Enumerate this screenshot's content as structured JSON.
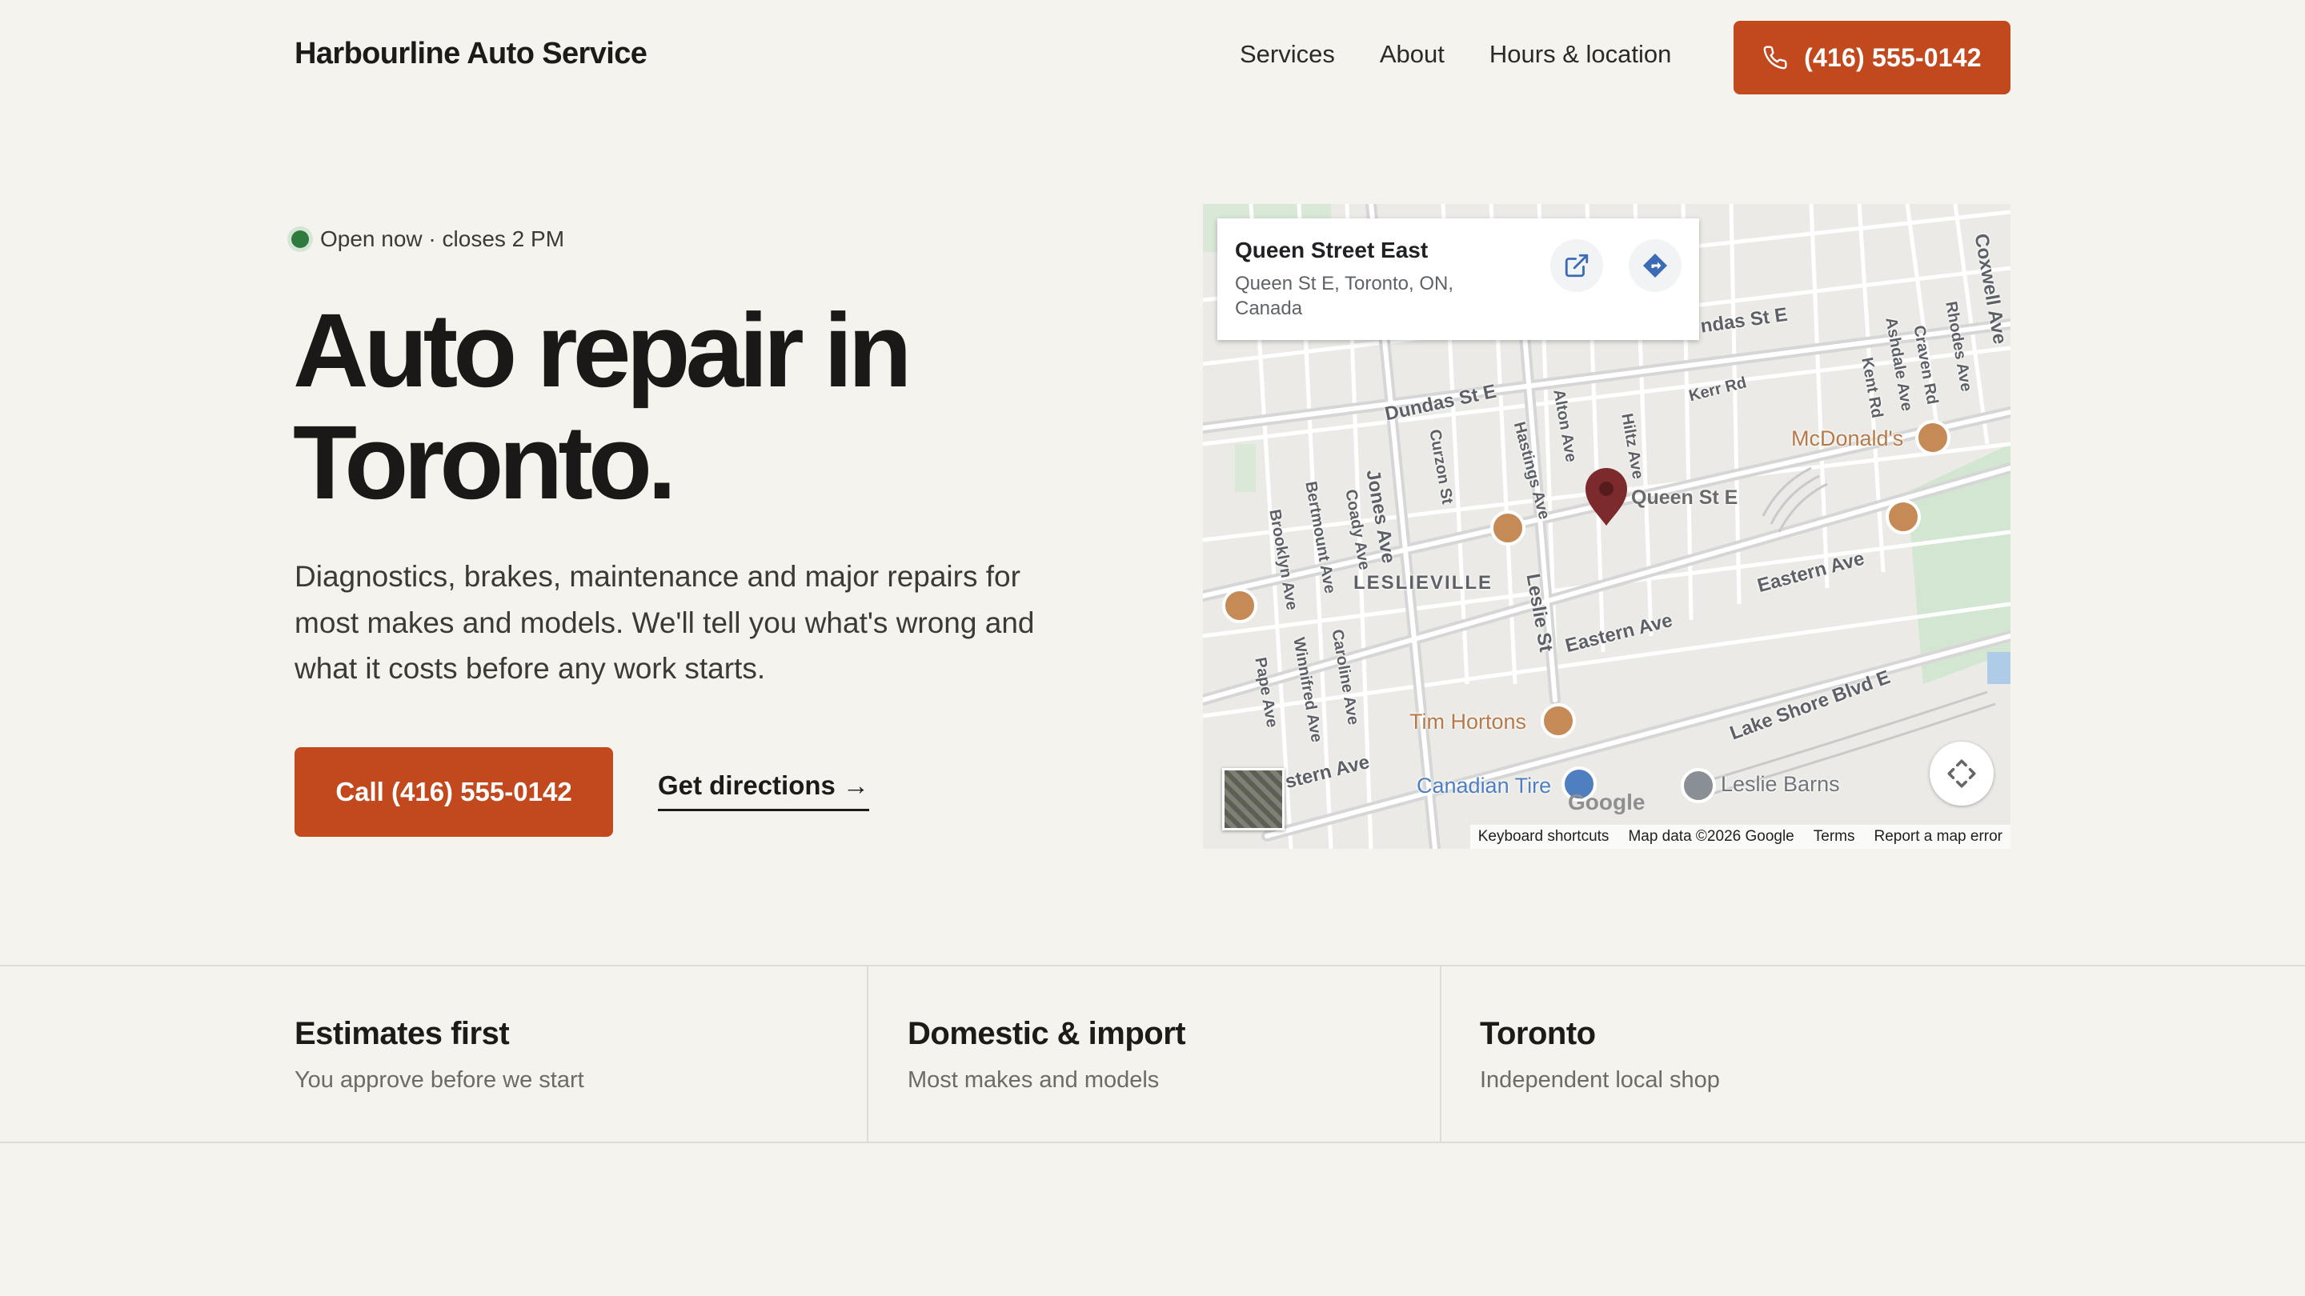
{
  "header": {
    "brand": "Harbourline Auto Service",
    "nav": [
      "Services",
      "About",
      "Hours & location"
    ],
    "phone_button": "(416) 555-0142",
    "accent_color": "#c2491d"
  },
  "hero": {
    "status": "Open now · closes 2 PM",
    "title_line1": "Auto repair in",
    "title_line2": "Toronto.",
    "description": "Diagnostics, brakes, maintenance and major repairs for most makes and models. We'll tell you what's wrong and what it costs before any work starts.",
    "call_button": "Call (416) 555-0142",
    "directions_link": "Get directions →"
  },
  "map": {
    "card_title": "Queen Street East",
    "card_address": "Queen St E, Toronto, ON, Canada",
    "open_icon": "open-in-new-icon",
    "directions_icon": "directions-icon",
    "fullscreen_icon": "fullscreen-icon",
    "google_logo": "Google",
    "streets": {
      "dundas": "Dundas St E",
      "dundas_right": "ndas St E",
      "queen": "Queen St E",
      "eastern1": "Eastern Ave",
      "eastern2": "Eastern Ave",
      "lakeshore": "Lake Shore Blvd E",
      "kerr": "Kerr Rd",
      "jones": "Jones Ave",
      "leslie": "Leslie St",
      "leslieville": "LESLIEVILLE",
      "curzon": "Curzon St",
      "hastings": "Hastings Ave",
      "alton": "Alton Ave",
      "hiltz": "Hiltz Ave",
      "brooklyn": "Brooklyn Ave",
      "bertmount": "Bertmount Ave",
      "coady": "Coady Ave",
      "winnifred": "Winnifred Ave",
      "caroline": "Caroline Ave",
      "pape": "Pape Ave",
      "kent": "Kent Rd",
      "ashdale": "Ashdale Ave",
      "craven": "Craven Rd",
      "rhodes": "Rhodes Ave",
      "coxwell": "Coxwell Ave",
      "eastern_left": "stern Ave"
    },
    "pois": {
      "mcdonalds": "McDonald's",
      "tim_hortons": "Tim Hortons",
      "canadian_tire": "Canadian Tire",
      "leslie_barns": "Leslie Barns"
    },
    "footer": [
      "Keyboard shortcuts",
      "Map data ©2026 Google",
      "Terms",
      "Report a map error"
    ]
  },
  "features": [
    {
      "title": "Estimates first",
      "subtitle": "You approve before we start"
    },
    {
      "title": "Domestic & import",
      "subtitle": "Most makes and models"
    },
    {
      "title": "Toronto",
      "subtitle": "Independent local shop"
    }
  ]
}
